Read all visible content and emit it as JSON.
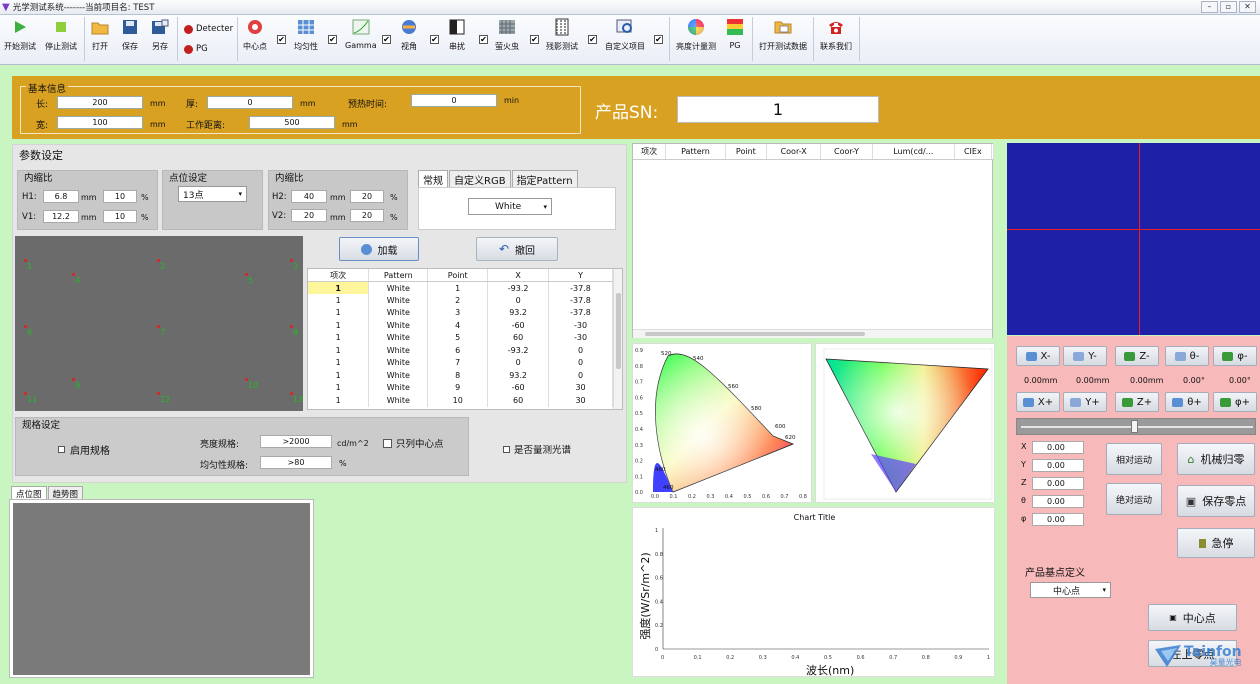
{
  "window": {
    "title": "光学测试系统-------当前项目名: TEST",
    "btn_min": "–",
    "btn_max": "▫",
    "btn_close": "✕"
  },
  "toolbar": {
    "start": "开始测试",
    "stop": "停止测试",
    "open": "打开",
    "save": "保存",
    "saveas": "另存",
    "detecter": "Detecter",
    "pg": "PG",
    "center": "中心点",
    "uniformity": "均匀性",
    "gamma": "Gamma",
    "view": "视角",
    "crosstalk": "串扰",
    "firefly": "萤火虫",
    "moire": "残影测试",
    "custom": "自定义项目",
    "luminance": "亮度计量测",
    "pg2": "PG",
    "open_data": "打开测试数据",
    "contact": "联系我们",
    "checks": [
      "✔",
      "✔",
      "✔",
      "✔",
      "✔",
      "✔",
      "✔",
      "✔"
    ]
  },
  "basic": {
    "caption": "基本信息",
    "length_label": "长:",
    "length": "200",
    "width_label": "宽:",
    "width": "100",
    "unit_mm": "mm",
    "thick_label": "厚:",
    "thick": "0",
    "workdist_label": "工作距离:",
    "workdist": "500",
    "preheat_label": "预热时间:",
    "preheat": "0",
    "min": "min"
  },
  "sn": {
    "label": "产品SN:",
    "value": "1"
  },
  "params": {
    "title": "参数设定",
    "inner1": {
      "caption": "内缩比",
      "h1_label": "H1:",
      "h1": "6.8",
      "h1p": "10",
      "v1_label": "V1:",
      "v1": "12.2",
      "v1p": "10",
      "mm": "mm",
      "pct": "%"
    },
    "pointset": {
      "caption": "点位设定",
      "value": "13点"
    },
    "inner2": {
      "caption": "内缩比",
      "h2_label": "H2:",
      "h2": "40",
      "h2p": "20",
      "v2_label": "V2:",
      "v2": "20",
      "v2p": "20",
      "mm": "mm",
      "pct": "%"
    },
    "tabs": [
      "常规",
      "自定义RGB",
      "指定Pattern"
    ],
    "pattern": "White",
    "load": "加载",
    "undo": "撤回"
  },
  "points": [
    "1",
    "2",
    "3",
    "4",
    "5",
    "6",
    "7",
    "8",
    "9",
    "10",
    "11",
    "12",
    "13"
  ],
  "pointtable": {
    "headers": [
      "项次",
      "Pattern",
      "Point",
      "X",
      "Y"
    ],
    "rows": [
      [
        "1",
        "White",
        "1",
        "-93.2",
        "-37.8"
      ],
      [
        "1",
        "White",
        "2",
        "0",
        "-37.8"
      ],
      [
        "1",
        "White",
        "3",
        "93.2",
        "-37.8"
      ],
      [
        "1",
        "White",
        "4",
        "-60",
        "-30"
      ],
      [
        "1",
        "White",
        "5",
        "60",
        "-30"
      ],
      [
        "1",
        "White",
        "6",
        "-93.2",
        "0"
      ],
      [
        "1",
        "White",
        "7",
        "0",
        "0"
      ],
      [
        "1",
        "White",
        "8",
        "93.2",
        "0"
      ],
      [
        "1",
        "White",
        "9",
        "-60",
        "30"
      ],
      [
        "1",
        "White",
        "10",
        "60",
        "30"
      ]
    ]
  },
  "spec": {
    "caption": "规格设定",
    "enable": "启用规格",
    "lum_label": "亮度规格:",
    "lum": ">2000",
    "lum_unit": "cd/m^2",
    "only_center": "只列中心点",
    "uni_label": "均匀性规格:",
    "uni": ">80",
    "uni_unit": "%",
    "spectrum": "是否量测光谱"
  },
  "bottom_tabs": [
    "点位图",
    "趋势图"
  ],
  "result_headers": [
    "项次",
    "Pattern",
    "Point",
    "Coor-X",
    "Coor-Y",
    "Lum(cd/...",
    "CIEx"
  ],
  "cie1": {
    "yticks": [
      "0.9",
      "0.8",
      "0.7",
      "0.6",
      "0.5",
      "0.4",
      "0.3",
      "0.2",
      "0.1",
      "0.0"
    ],
    "xticks": [
      "0.0",
      "0.1",
      "0.2",
      "0.3",
      "0.4",
      "0.5",
      "0.6",
      "0.7",
      "0.8"
    ],
    "wl": [
      "520",
      "540",
      "560",
      "580",
      "600",
      "620",
      "480",
      "460"
    ]
  },
  "spectrum_chart": {
    "title": "Chart Title",
    "ylabel": "强度(W/Sr/m^2)",
    "xlabel": "波长(nm)",
    "xticks": [
      "0",
      "0.1",
      "0.2",
      "0.3",
      "0.4",
      "0.5",
      "0.6",
      "0.7",
      "0.8",
      "0.9",
      "1"
    ],
    "yticks": [
      "1",
      "0.8",
      "0.6",
      "0.4",
      "0.2",
      "0"
    ]
  },
  "motion": {
    "xm": "X-",
    "ym": "Y-",
    "zm": "Z-",
    "tm": "θ-",
    "pm": "φ-",
    "xp": "X+",
    "yp": "Y+",
    "zp": "Z+",
    "tp": "θ+",
    "pp": "φ+",
    "readouts": [
      "0.00mm",
      "0.00mm",
      "0.00mm",
      "0.00°",
      "0.00°"
    ],
    "axes": [
      {
        "n": "X",
        "v": "0.00"
      },
      {
        "n": "Y",
        "v": "0.00"
      },
      {
        "n": "Z",
        "v": "0.00"
      },
      {
        "n": "θ",
        "v": "0.00"
      },
      {
        "n": "φ",
        "v": "0.00"
      }
    ],
    "relative": "相对运动",
    "absolute": "绝对运动",
    "home": "机械归零",
    "savezero": "保存零点",
    "estop": "急停",
    "basedef": "产品基点定义",
    "basesel": "中心点",
    "center_btn": "中心点",
    "corner_btn": "左上零点"
  },
  "watermark": {
    "brand": "Tainfon",
    "sub": "昊量光电"
  },
  "colors": {
    "gold": "#d9a121",
    "green": "#c8f5c0",
    "pink": "#f7b9b9",
    "camera": "#1f20a8"
  }
}
